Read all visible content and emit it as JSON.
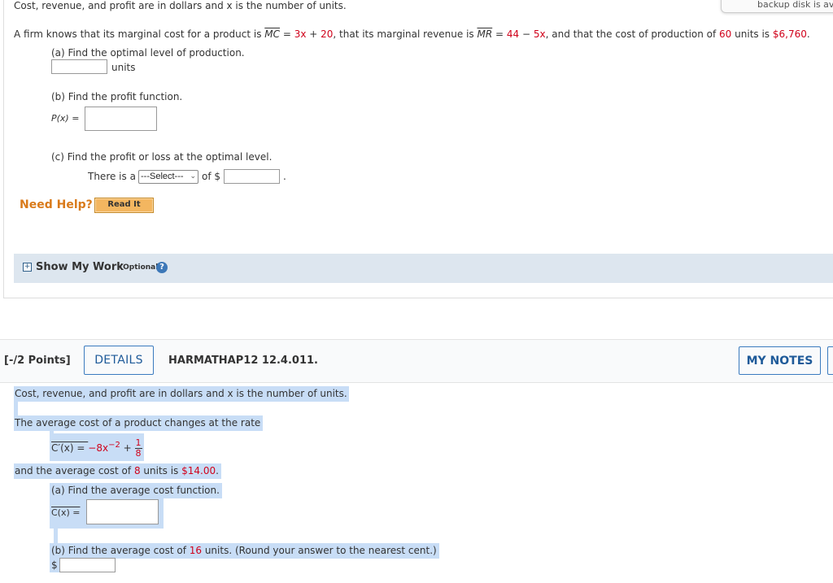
{
  "q1": {
    "top_line": "Cost, revenue, and profit are in dollars and x is the number of units.",
    "problem": {
      "p1": "A firm knows that its marginal cost for a product is ",
      "mc_label": "MC",
      "p2": " = ",
      "mc_expr_a": "3x",
      "mc_plus": " + ",
      "mc_expr_b": "20",
      "p3": ", that its marginal revenue is ",
      "mr_label": "MR",
      "p4": " = ",
      "mr_a": "44",
      "mr_minus": " − ",
      "mr_b": "5x",
      "p5": ", and that the cost of production of ",
      "units": "60",
      "p6": " units is ",
      "cost": "$6,760",
      "p7": "."
    },
    "part_a": {
      "label": "(a) Find the optimal level of production.",
      "unit": "units",
      "value": ""
    },
    "part_b": {
      "label": "(b) Find the profit function.",
      "prefix": "P(x) =",
      "value": ""
    },
    "part_c": {
      "label": "(c) Find the profit or loss at the optimal level.",
      "prefix": "There is a",
      "select": "---Select---",
      "mid": "of $",
      "end": ".",
      "value": ""
    },
    "need_help": "Need Help?",
    "read_it": "Read It",
    "show_work": "Show My Work",
    "optional": "(Optional)",
    "backup": "backup disk is availa"
  },
  "q2": {
    "points": "[-/2 Points]",
    "details": "DETAILS",
    "code": "HARMATHAP12 12.4.011.",
    "my_notes": "MY NOTES",
    "line1": "Cost, revenue, and profit are in dollars and x is the number of units.",
    "line2": "The average cost of a product changes at the rate",
    "deriv_lhs": "C′(x) = ",
    "deriv_coef": "−8x",
    "deriv_exp": "−2",
    "deriv_plus": " + ",
    "frac_num": "1",
    "frac_den": "8",
    "line3_a": "and the average cost of ",
    "line3_units": "8",
    "line3_b": " units is ",
    "line3_cost": "$14.00",
    "line3_c": ".",
    "part_a": {
      "label": "(a) Find the average cost function.",
      "prefix": "C(x) =",
      "value": ""
    },
    "part_b": {
      "label_a": "(b) Find the average cost of ",
      "units": "16",
      "label_b": " units. (Round your answer to the nearest cent.)",
      "dollar": "$",
      "value": ""
    }
  },
  "colors": {
    "accent": "#1e5a99",
    "highlight": "#c8ddf6",
    "red": "#d0021b",
    "help_orange": "#d97a1a"
  }
}
